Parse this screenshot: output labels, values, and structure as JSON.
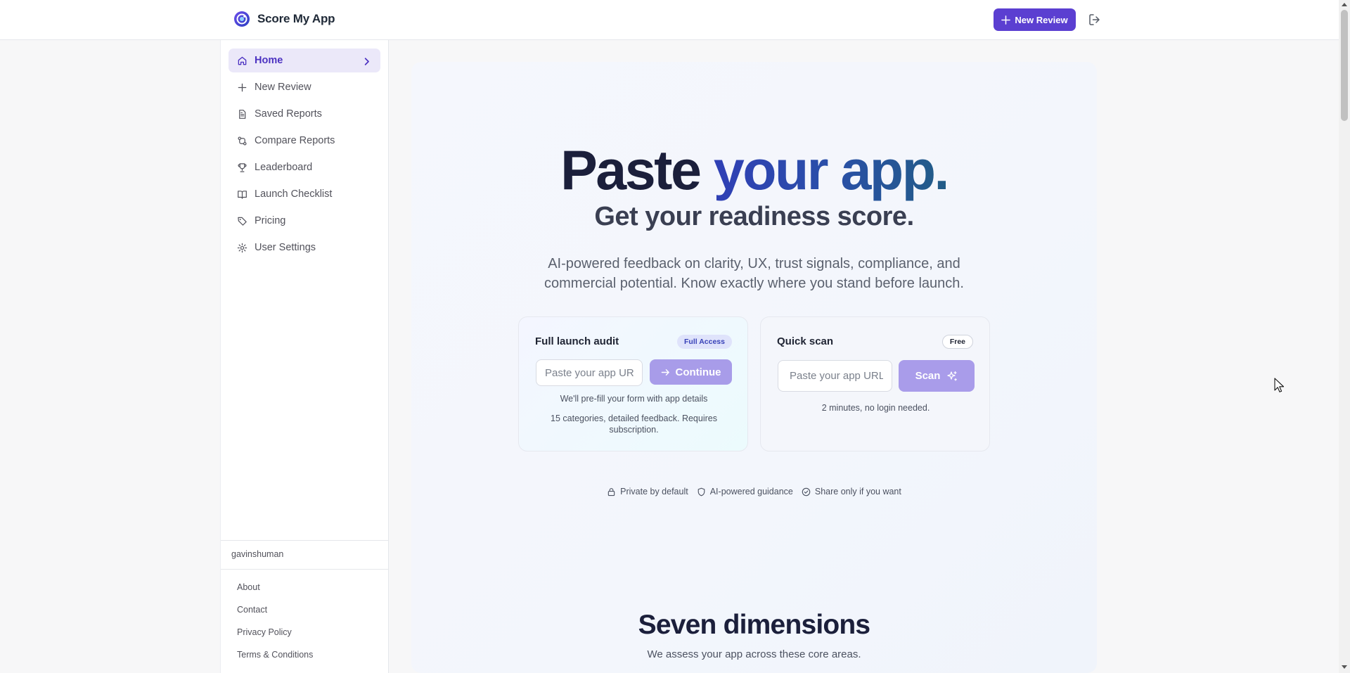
{
  "app": {
    "name": "Score My App"
  },
  "header": {
    "new_review_label": "New Review"
  },
  "sidebar": {
    "items": [
      {
        "label": "Home",
        "icon": "home-icon",
        "active": true
      },
      {
        "label": "New Review",
        "icon": "plus-icon"
      },
      {
        "label": "Saved Reports",
        "icon": "file-icon"
      },
      {
        "label": "Compare Reports",
        "icon": "compare-icon"
      },
      {
        "label": "Leaderboard",
        "icon": "trophy-icon"
      },
      {
        "label": "Launch Checklist",
        "icon": "book-icon"
      },
      {
        "label": "Pricing",
        "icon": "tag-icon"
      },
      {
        "label": "User Settings",
        "icon": "gear-icon"
      }
    ],
    "username": "gavinshuman",
    "footer_links": [
      "About",
      "Contact",
      "Privacy Policy",
      "Terms & Conditions"
    ]
  },
  "hero": {
    "title_dark": "Paste",
    "title_grad": "your app.",
    "subtitle": "Get your readiness score.",
    "description": "AI-powered feedback on clarity, UX, trust signals, compliance, and commercial potential. Know exactly where you stand before launch."
  },
  "full_audit": {
    "title": "Full launch audit",
    "badge": "Full Access",
    "input_placeholder": "Paste your app URL",
    "button_label": "Continue",
    "note1": "We'll pre-fill your form with app details",
    "note2": "15 categories, detailed feedback. Requires subscription."
  },
  "quick_scan": {
    "title": "Quick scan",
    "badge": "Free",
    "input_placeholder": "Paste your app URL",
    "button_label": "Scan",
    "note": "2 minutes, no login needed."
  },
  "trust": [
    {
      "label": "Private by default",
      "icon": "lock-icon"
    },
    {
      "label": "AI-powered guidance",
      "icon": "shield-icon"
    },
    {
      "label": "Share only if you want",
      "icon": "check-circle-icon"
    }
  ],
  "dimensions": {
    "title": "Seven dimensions",
    "subtitle": "We assess your app across these core areas."
  },
  "colors": {
    "brand": "#5b3fd1",
    "active_bg": "#ebe8f9",
    "button_muted": "#a89ce9",
    "title_dark": "#1b1f3b"
  }
}
